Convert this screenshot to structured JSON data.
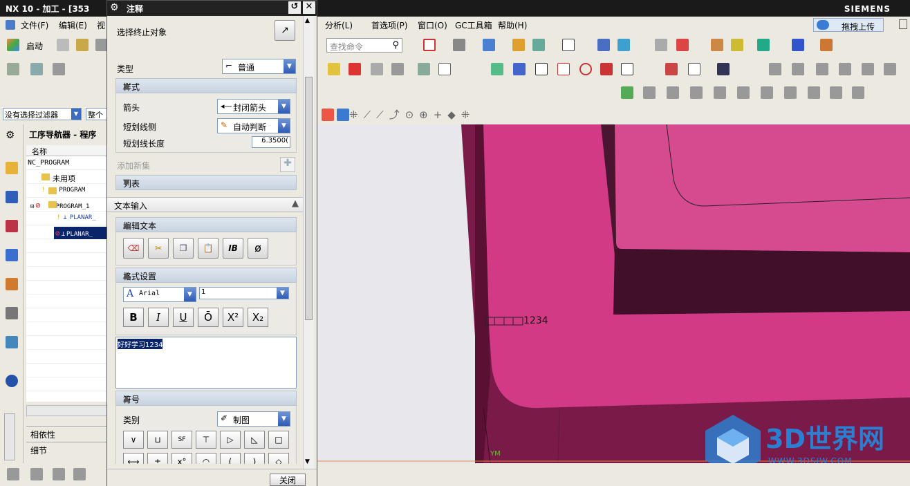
{
  "window": {
    "title": "NX 10 - 加工 - [353",
    "brand": "SIEMENS",
    "upload_button": "拖拽上传"
  },
  "menubar": {
    "items": [
      "文件(F)",
      "编辑(E)",
      "视",
      "分析(L)",
      "首选项(P)",
      "窗口(O)",
      "GC工具箱",
      "帮助(H)"
    ]
  },
  "toolbar": {
    "start_label": "启动",
    "search_placeholder": "查找命令"
  },
  "filter": {
    "selection_filter": "没有选择过滤器",
    "scope": "整个"
  },
  "navigator": {
    "title": "工序导航器 - 程序",
    "column_header": "名称",
    "rows": [
      "NC_PROGRAM",
      "未用项",
      "PROGRAM",
      "PROGRAM_1",
      "PLANAR_",
      "PLANAR_"
    ],
    "bottom_tabs": [
      "相依性",
      "细节"
    ]
  },
  "dialog": {
    "title": "注释",
    "select_end": "选择终止对象",
    "type_label": "类型",
    "type_value": "普通",
    "style": {
      "header": "样式",
      "arrow_label": "箭头",
      "arrow_value": "封闭箭头",
      "stub_side_label": "短划线侧",
      "stub_side_value": "自动判断",
      "stub_length_label": "短划线长度",
      "stub_length_value": "6.3500("
    },
    "add_set": "添加新集",
    "list_header": "列表",
    "text_input_header": "文本输入",
    "edit_text_header": "编辑文本",
    "format_header": "格式设置",
    "font_name": "Arial",
    "font_size": "1",
    "format_buttons": [
      "B",
      "I",
      "U",
      "Ō",
      "X²",
      "X₂"
    ],
    "text_content": "好好学习1234",
    "symbol": {
      "header": "符号",
      "category_label": "类别",
      "category_value": "制图",
      "row1": [
        "∨",
        "⊔",
        "SF",
        "⊤",
        "▷",
        "◺",
        "□"
      ],
      "row2": [
        "⟷",
        "±",
        "x°",
        "◠",
        "(",
        ")",
        "◇"
      ]
    },
    "close_button": "关闭"
  },
  "viewport": {
    "annotation_text": "1234",
    "axis_label": "YM",
    "part_color": "#d0307e",
    "watermark_main": "3D世界网",
    "watermark_url": "WWW.3DSJW.COM"
  }
}
